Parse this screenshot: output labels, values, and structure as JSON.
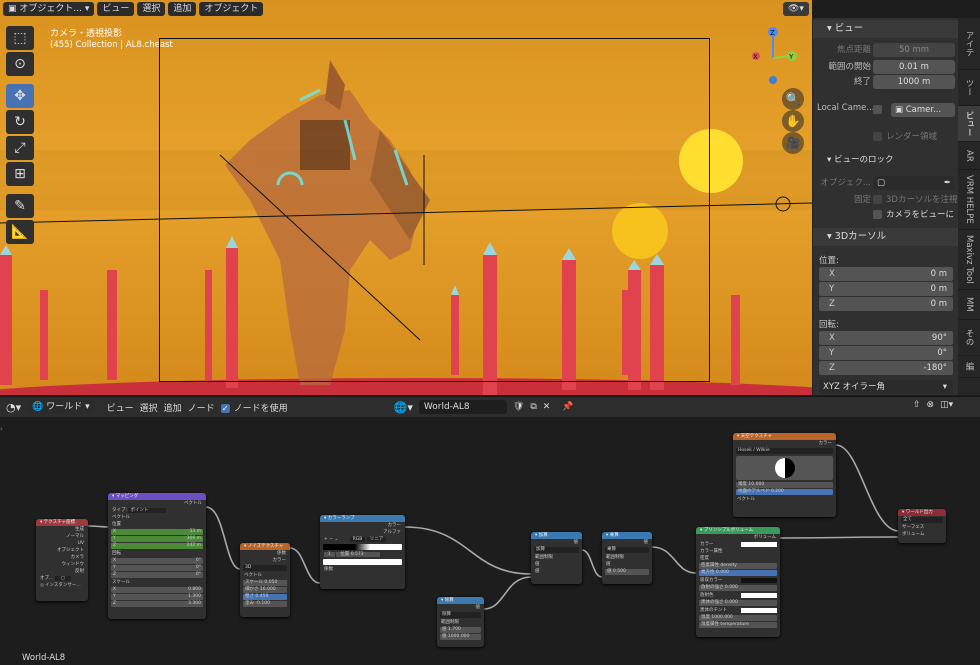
{
  "viewport": {
    "mode_label": "オブジェクト...",
    "menus": [
      "ビュー",
      "選択",
      "追加",
      "オブジェクト"
    ],
    "camera_title": "カメラ・透視投影",
    "camera_sub": "(455) Collection | AL8.cheast"
  },
  "npanel": {
    "view_section": "ビュー",
    "focal_label": "焦点距離",
    "focal_value": "50 mm",
    "clip_start_label": "範囲の開始",
    "clip_start_value": "0.01 m",
    "clip_end_label": "終了",
    "clip_end_value": "1000 m",
    "local_camera_label": "Local Came...",
    "local_camera_value": "Camer...",
    "render_region_label": "レンダー領域",
    "view_lock_label": "ビューのロック",
    "object_label": "オブジェク...",
    "lock_label": "固定",
    "lock_cursor_label": "3Dカーソルを注視",
    "camera_to_view_label": "カメラをビューに",
    "cursor_section": "3Dカーソル",
    "location_label": "位置:",
    "loc": [
      {
        "axis": "X",
        "value": "0 m"
      },
      {
        "axis": "Y",
        "value": "0 m"
      },
      {
        "axis": "Z",
        "value": "0 m"
      }
    ],
    "rotation_label": "回転:",
    "rot": [
      {
        "axis": "X",
        "value": "90°"
      },
      {
        "axis": "Y",
        "value": "0°"
      },
      {
        "axis": "Z",
        "value": "-180°"
      }
    ],
    "rotation_mode": "XYZ オイラー角",
    "tabs": [
      "アイテ",
      "ツー",
      "ビュー",
      "AR",
      "VRM HELPE",
      "Maxivz Tool",
      "MM",
      "その",
      "編"
    ]
  },
  "node_editor": {
    "editor_label": "ワールド",
    "menus": [
      "ビュー",
      "選択",
      "追加",
      "ノード"
    ],
    "use_nodes_label": "ノードを使用",
    "world_name": "World-AL8",
    "footer_name": "World-AL8"
  },
  "nodes": {
    "texcoord": {
      "title": "テクスチャ座標",
      "outputs": [
        "生成",
        "ノーマル",
        "UV",
        "オブジェクト",
        "カメラ",
        "ウィンドウ",
        "反射"
      ],
      "obj_label": "オブ...",
      "instancer": "インスタンサー..."
    },
    "mapping": {
      "title": "マッピング",
      "out": "ベクトル",
      "type_label": "タイプ:",
      "type_value": "ポイント",
      "vector": "ベクトル",
      "loc_label": "位置",
      "loc": [
        "X",
        "Y",
        "Z"
      ],
      "loc_values": [
        "33 m",
        "306 m",
        "242 m"
      ],
      "rot_label": "回転",
      "rot": [
        "X",
        "Y",
        "Z"
      ],
      "rot_values": [
        "0°",
        "0°",
        "0°"
      ],
      "scale_label": "スケール",
      "scale": [
        "X",
        "Y",
        "Z"
      ],
      "scale_values": [
        "0.800",
        "1.300",
        "3.300"
      ]
    },
    "noise": {
      "title": "ノイズテクスチャ",
      "outs": [
        "係数",
        "カラー"
      ],
      "dim": "3D",
      "vector": "ベクトル",
      "fields": [
        "スケール 0.050",
        "細かさ 16.000",
        "粗さ 0.459",
        "歪み -0.100"
      ]
    },
    "ramp": {
      "title": "カラーランプ",
      "outs": [
        "カラー",
        "アルファ"
      ],
      "mode": "RGB",
      "interp": "リニア",
      "idx": "1",
      "pos_label": "位置",
      "pos_value": "0.573",
      "fac": "係数"
    },
    "add": {
      "title": "加算",
      "out": "値",
      "op": "加算",
      "clamp": "範囲制限",
      "in1": "値",
      "in2": "値"
    },
    "mult": {
      "title": "乗算",
      "out": "値",
      "op": "乗算",
      "clamp": "範囲制限",
      "in1": "値",
      "in2": "値 0.500"
    },
    "divide": {
      "title": "除算",
      "out": "値",
      "op": "除算",
      "clamp": "範囲制限",
      "in1": "値 1.700",
      "in2": "値 1000.000"
    },
    "sky": {
      "title": "天空テクスチャ",
      "out": "カラー",
      "type": "Hosek / Wilkie",
      "f1": "濁度 10.000",
      "f2": "地面のアルベド 0.200",
      "vector": "ベクトル"
    },
    "volume": {
      "title": "プリンシプルボリューム",
      "out": "ボリューム",
      "ins": [
        "カラー",
        "カラー属性",
        "密度",
        "密度属性 density",
        "異方性 0.000",
        "吸収カラー",
        "放射の強さ 0.000",
        "放射色",
        "黒体の強さ 0.000",
        "黒体のチント",
        "温度 1000.000",
        "温度属性 temperature"
      ]
    },
    "output": {
      "title": "ワールド出力",
      "target": "全て",
      "ins": [
        "サーフェス",
        "ボリューム"
      ]
    }
  }
}
